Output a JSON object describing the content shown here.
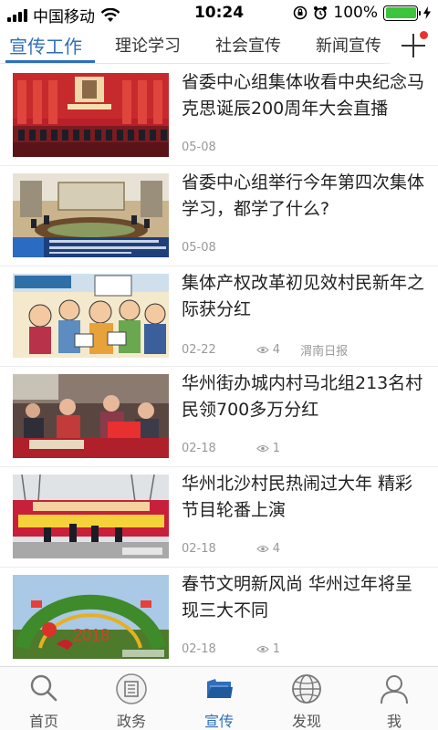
{
  "status_bar": {
    "carrier": "中国移动",
    "time": "10:24",
    "battery": "100%"
  },
  "tabs": [
    {
      "label": "宣传工作",
      "active": true
    },
    {
      "label": "理论学习",
      "active": false
    },
    {
      "label": "社会宣传",
      "active": false
    },
    {
      "label": "新闻宣传",
      "active": false
    }
  ],
  "news": [
    {
      "title": "省委中心组集体收看中央纪念马克思诞辰200周年大会直播",
      "date": "05-08",
      "views": "",
      "source": ""
    },
    {
      "title": "省委中心组举行今年第四次集体学习，都学了什么?",
      "date": "05-08",
      "views": "",
      "source": ""
    },
    {
      "title": "集体产权改革初见效村民新年之际获分红",
      "date": "02-22",
      "views": "4",
      "source": "渭南日报"
    },
    {
      "title": "华州街办城内村马北组213名村民领700多万分红",
      "date": "02-18",
      "views": "1",
      "source": ""
    },
    {
      "title": "华州北沙村民热闹过大年 精彩节目轮番上演",
      "date": "02-18",
      "views": "4",
      "source": ""
    },
    {
      "title": "春节文明新风尚 华州过年将呈现三大不同",
      "date": "02-18",
      "views": "1",
      "source": ""
    }
  ],
  "bottom_nav": [
    {
      "label": "首页",
      "icon": "search-icon",
      "active": false
    },
    {
      "label": "政务",
      "icon": "document-icon",
      "active": false
    },
    {
      "label": "宣传",
      "icon": "folder-icon",
      "active": true
    },
    {
      "label": "发现",
      "icon": "globe-icon",
      "active": false
    },
    {
      "label": "我",
      "icon": "person-icon",
      "active": false
    }
  ],
  "colors": {
    "accent": "#2f6fb8",
    "badge": "#e8322f",
    "battery": "#3cc43c"
  }
}
